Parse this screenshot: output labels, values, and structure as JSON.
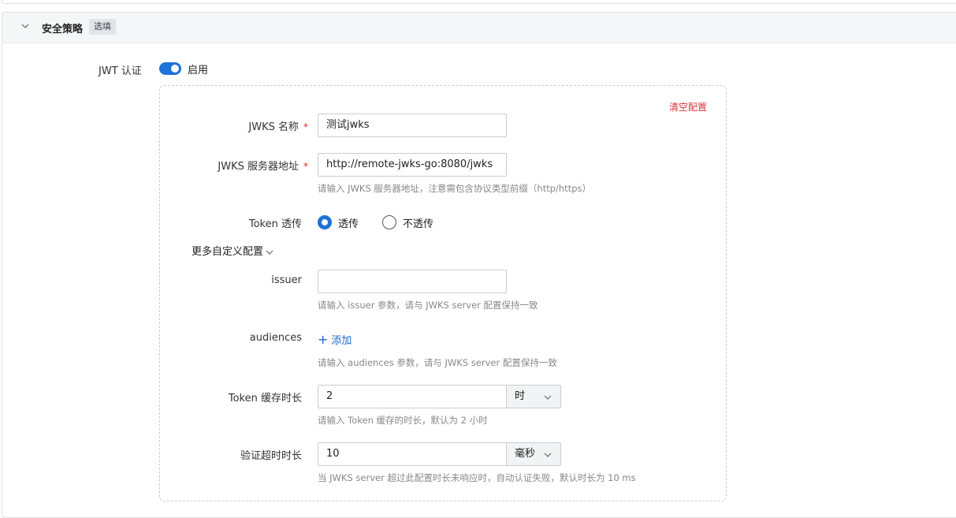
{
  "section": {
    "title": "安全策略",
    "tag": "选填"
  },
  "jwt": {
    "label": "JWT 认证",
    "switch_text": "启用"
  },
  "clear_config": "清空配置",
  "jwks_name": {
    "label": "JWKS 名称",
    "required_mark": "*",
    "value": "测试jwks"
  },
  "jwks_server": {
    "label": "JWKS 服务器地址",
    "required_mark": "*",
    "value": "http://remote-jwks-go:8080/jwks",
    "hint": "请输入 JWKS 服务器地址，注意需包含协议类型前缀（http/https）"
  },
  "token_pass": {
    "label": "Token 透传",
    "option_on": "透传",
    "option_off": "不透传"
  },
  "more_config": "更多自定义配置",
  "issuer": {
    "label": "issuer",
    "value": "",
    "hint": "请输入 issuer 参数，请与 JWKS server 配置保持一致"
  },
  "audiences": {
    "label": "audiences",
    "add_label": "添加",
    "hint": "请输入 audiences 参数，请与 JWKS server 配置保持一致"
  },
  "token_cache": {
    "label": "Token 缓存时长",
    "value": "2",
    "unit": "时",
    "hint": "请输入 Token 缓存的时长，默认为 2 小时"
  },
  "verify_timeout": {
    "label": "验证超时时长",
    "value": "10",
    "unit": "毫秒",
    "hint": "当 JWKS server 超过此配置时长未响应时，自动认证失败，默认时长为 10 ms"
  }
}
